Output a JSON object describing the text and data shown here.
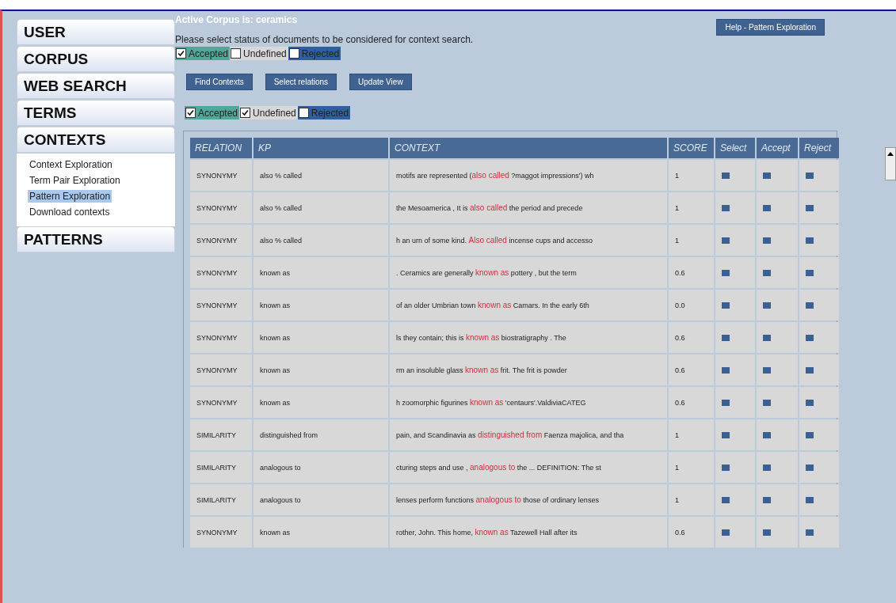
{
  "sidebar": {
    "sections": [
      {
        "label": "USER"
      },
      {
        "label": "CORPUS"
      },
      {
        "label": "WEB SEARCH"
      },
      {
        "label": "TERMS"
      },
      {
        "label": "CONTEXTS",
        "items": [
          {
            "label": "Context Exploration",
            "selected": false
          },
          {
            "label": "Term Pair Exploration",
            "selected": false
          },
          {
            "label": "Pattern Exploration",
            "selected": true
          },
          {
            "label": "Download contexts",
            "selected": false
          }
        ]
      },
      {
        "label": "PATTERNS"
      }
    ]
  },
  "active_corpus": "Active Corpus is: ceramics",
  "help_button": "Help - Pattern Exploration",
  "instruction": "Please select status of documents to be considered for context search.",
  "status_filter": [
    {
      "label": "Accepted",
      "checked": true,
      "color": "#4fa89a"
    },
    {
      "label": "Undefined",
      "checked": false,
      "color": "#d8d8d8"
    },
    {
      "label": "Rejected",
      "checked": false,
      "color": "#2f5f9c"
    }
  ],
  "actions": [
    "Find Contexts",
    "Select relations",
    "Update View"
  ],
  "view_filter": [
    {
      "label": "Accepted",
      "checked": true,
      "color": "#4fa89a"
    },
    {
      "label": "Undefined",
      "checked": true,
      "color": "#d8d8d8"
    },
    {
      "label": "Rejected",
      "checked": false,
      "color": "#2f5f9c"
    }
  ],
  "table": {
    "columns": [
      "RELATION",
      "KP",
      "CONTEXT",
      "SCORE",
      "Select",
      "Accept",
      "Reject"
    ],
    "rows": [
      {
        "relation": "SYNONYMY",
        "kp": "also % called",
        "before": "motifs are represented (",
        "match": "also called",
        "after": " ?maggot impressions') wh",
        "score": "1",
        "select": false,
        "accept": false,
        "reject": false
      },
      {
        "relation": "SYNONYMY",
        "kp": "also % called",
        "before": "the Mesoamerica , It is ",
        "match": "also called",
        "after": " the period and precede",
        "score": "1",
        "select": false,
        "accept": false,
        "reject": false
      },
      {
        "relation": "SYNONYMY",
        "kp": "also % called",
        "before": "h an urn of some kind. ",
        "match": "Also called",
        "after": " incense cups and accesso",
        "score": "1",
        "select": false,
        "accept": false,
        "reject": false
      },
      {
        "relation": "SYNONYMY",
        "kp": "known as",
        "before": ". Ceramics are generally ",
        "match": "known as",
        "after": " pottery , but the term",
        "score": "0.6",
        "select": false,
        "accept": false,
        "reject": false
      },
      {
        "relation": "SYNONYMY",
        "kp": "known as",
        "before": "of an older Umbrian town ",
        "match": "known as",
        "after": " Camars. In the early 6th",
        "score": "0.0",
        "select": false,
        "accept": false,
        "reject": false
      },
      {
        "relation": "SYNONYMY",
        "kp": "known as",
        "before": "ls they contain; this is ",
        "match": "known as",
        "after": " biostratigraphy . The",
        "score": "0.6",
        "select": false,
        "accept": false,
        "reject": false
      },
      {
        "relation": "SYNONYMY",
        "kp": "known as",
        "before": "rm an insoluble glass ",
        "match": "known as",
        "after": " frit. The frit is powder",
        "score": "0.6",
        "select": false,
        "accept": false,
        "reject": false
      },
      {
        "relation": "SYNONYMY",
        "kp": "known as",
        "before": "h zoomorphic figurines ",
        "match": "known as",
        "after": " 'centaurs'.ValdiviaCATEG",
        "score": "0.6",
        "select": false,
        "accept": false,
        "reject": false
      },
      {
        "relation": "SIMILARITY",
        "kp": "distinguished from",
        "before": "pain, and Scandinavia as ",
        "match": "distinguished from",
        "after": " Faenza majolica, and tha",
        "score": "1",
        "select": false,
        "accept": false,
        "reject": false
      },
      {
        "relation": "SIMILARITY",
        "kp": "analogous to",
        "before": "cturing steps and use , ",
        "match": "analogous to",
        "after": " the ... DEFINITION: The st",
        "score": "1",
        "select": false,
        "accept": false,
        "reject": false
      },
      {
        "relation": "SIMILARITY",
        "kp": "analogous to",
        "before": "lenses perform functions ",
        "match": "analogous to",
        "after": " those of ordinary lenses",
        "score": "1",
        "select": false,
        "accept": false,
        "reject": false
      },
      {
        "relation": "SYNONYMY",
        "kp": "known as",
        "before": "rother, John. This home, ",
        "match": "known as",
        "after": " Tazewell Hall after its",
        "score": "0.6",
        "select": false,
        "accept": false,
        "reject": false
      }
    ]
  }
}
